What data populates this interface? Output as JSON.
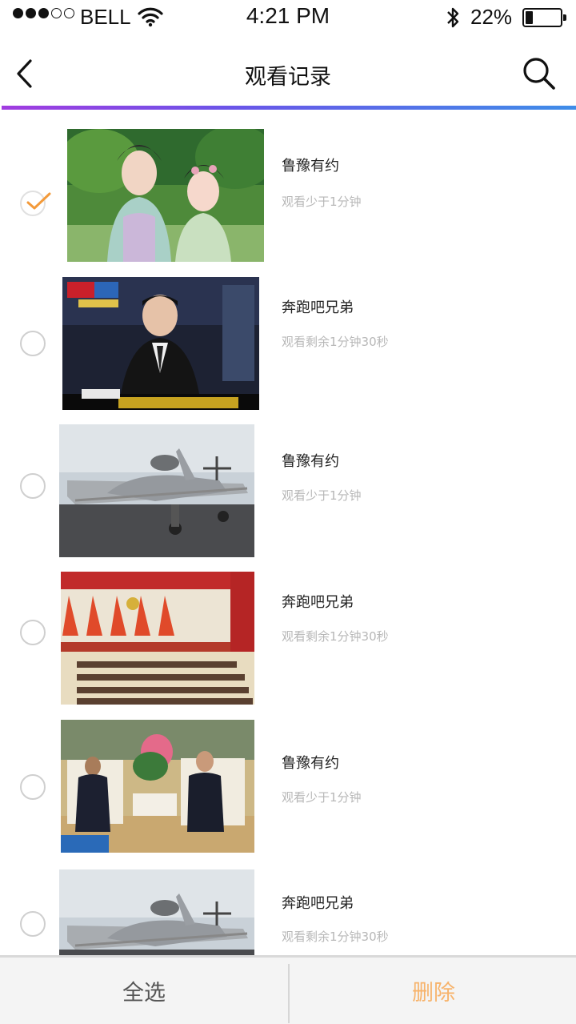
{
  "status_bar": {
    "carrier": "BELL",
    "time": "4:21 PM",
    "battery_percent": "22%",
    "battery_level": 0.22,
    "signal_bars_full": 3,
    "signal_bars_total": 5
  },
  "nav": {
    "title": "观看记录",
    "back_icon": "chevron-left-icon",
    "search_icon": "search-icon"
  },
  "colors": {
    "accent_gradient_start": "#a13ce0",
    "accent_gradient_end": "#3f8de8",
    "check_orange": "#f39a3a",
    "delete_label": "#f7b36b"
  },
  "items": [
    {
      "title": "鲁豫有约",
      "subtitle": "观看少于1分钟",
      "checked": true,
      "thumbnail": "two-women-costume-photo"
    },
    {
      "title": "奔跑吧兄弟",
      "subtitle": "观看剩余1分钟30秒",
      "checked": false,
      "thumbnail": "tv-news-anchor-photo"
    },
    {
      "title": "鲁豫有约",
      "subtitle": "观看少于1分钟",
      "checked": false,
      "thumbnail": "fighter-jet-photo"
    },
    {
      "title": "奔跑吧兄弟",
      "subtitle": "观看剩余1分钟30秒",
      "checked": false,
      "thumbnail": "conference-hall-photo"
    },
    {
      "title": "鲁豫有约",
      "subtitle": "观看少于1分钟",
      "checked": false,
      "thumbnail": "two-men-meeting-photo"
    },
    {
      "title": "奔跑吧兄弟",
      "subtitle": "观看剩余1分钟30秒",
      "checked": false,
      "thumbnail": "fighter-jet-photo"
    }
  ],
  "toolbar": {
    "select_all": "全选",
    "delete": "删除"
  }
}
